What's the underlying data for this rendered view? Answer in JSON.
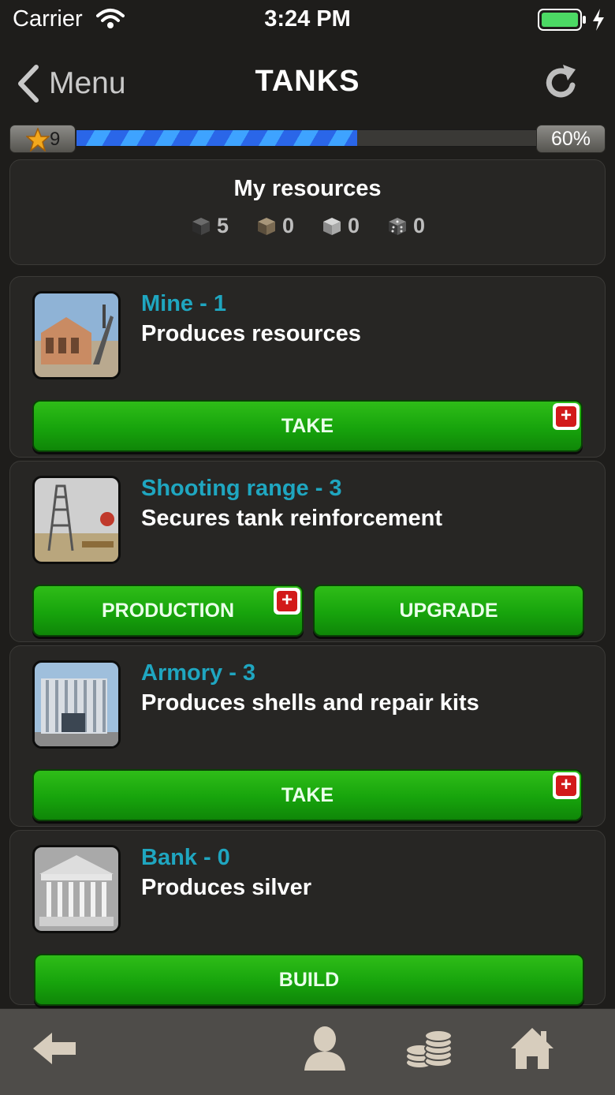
{
  "status_bar": {
    "carrier": "Carrier",
    "time": "3:24 PM"
  },
  "nav": {
    "back_label": "Menu",
    "title": "TANKS"
  },
  "progress": {
    "level": "9",
    "percent_label": "60%",
    "fill_fraction": 0.6
  },
  "resources": {
    "title": "My resources",
    "items": [
      {
        "icon": "dark-cube-icon",
        "value": "5"
      },
      {
        "icon": "brown-cube-icon",
        "value": "0"
      },
      {
        "icon": "grey-cube-icon",
        "value": "0"
      },
      {
        "icon": "dotted-cube-icon",
        "value": "0"
      }
    ]
  },
  "buildings": [
    {
      "name": "Mine - 1",
      "description": "Produces resources",
      "buttons": [
        {
          "label": "TAKE",
          "badge": "+"
        }
      ]
    },
    {
      "name": "Shooting range - 3",
      "description": "Secures tank reinforcement",
      "buttons": [
        {
          "label": "PRODUCTION",
          "badge": "+"
        },
        {
          "label": "UPGRADE"
        }
      ]
    },
    {
      "name": "Armory - 3",
      "description": "Produces shells and repair kits",
      "buttons": [
        {
          "label": "TAKE",
          "badge": "+"
        }
      ]
    },
    {
      "name": "Bank - 0",
      "description": "Produces silver",
      "buttons": [
        {
          "label": "BUILD"
        }
      ]
    }
  ],
  "tab_bar": {
    "icons": [
      "back-arrow-icon",
      "profile-icon",
      "coins-icon",
      "home-icon"
    ]
  },
  "colors": {
    "accent": "#1fa6c0",
    "button_green": "#17a40c",
    "badge_red": "#d21a1a",
    "progress_blue": "#2a66e8"
  }
}
